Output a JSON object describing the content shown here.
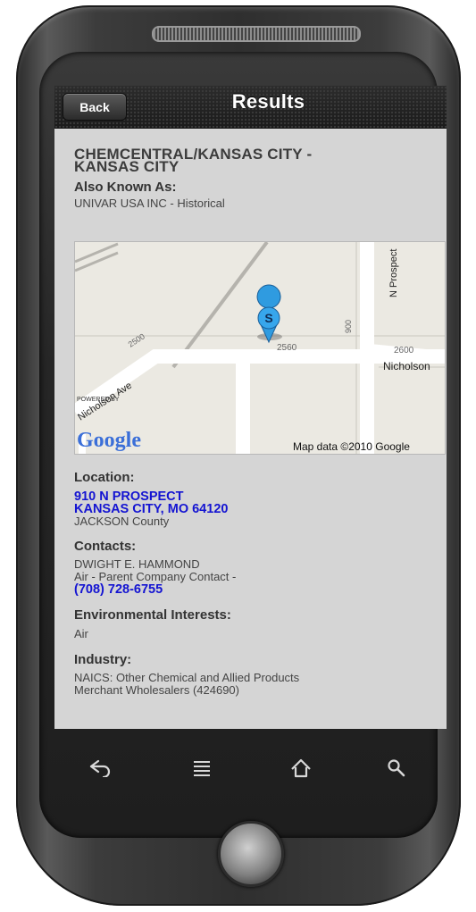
{
  "header": {
    "back_label": "Back",
    "title": "Results"
  },
  "facility": {
    "name_line1": "CHEMCENTRAL/KANSAS CITY -",
    "name_line2": "KANSAS CITY"
  },
  "aka": {
    "label": "Also Known As:",
    "value": "UNIVAR USA INC - Historical"
  },
  "map": {
    "labels": {
      "street_nicholson": "Nicholson",
      "street_nicholson_ave": "Nicholson Ave",
      "street_n_prospect": "N Prospect",
      "num_2500": "2500",
      "num_2560": "2560",
      "num_2600": "2600",
      "num_900": "900",
      "marker_letter": "S",
      "powered_by": "POWERED BY",
      "google": "Google",
      "attribution": "Map data ©2010 Google"
    }
  },
  "location": {
    "label": "Location:",
    "address_line1": "910 N PROSPECT",
    "address_line2": "KANSAS CITY, MO 64120",
    "county": "JACKSON County"
  },
  "contacts": {
    "label": "Contacts:",
    "name": "DWIGHT E. HAMMOND",
    "role": "Air - Parent Company Contact -",
    "phone": "(708) 728-6755"
  },
  "interests": {
    "label": "Environmental Interests:",
    "value": "Air"
  },
  "industry": {
    "label": "Industry:",
    "line1": "NAICS: Other Chemical and Allied Products",
    "line2": "Merchant Wholesalers (424690)"
  },
  "colors": {
    "link": "#1414d2",
    "screen_bg": "#d5d5d5",
    "titlebar": "#1e1e1e",
    "marker": "#2f9be0"
  },
  "icons": [
    "back-arrow-icon",
    "menu-icon",
    "home-icon",
    "search-icon",
    "map-marker-icon"
  ]
}
